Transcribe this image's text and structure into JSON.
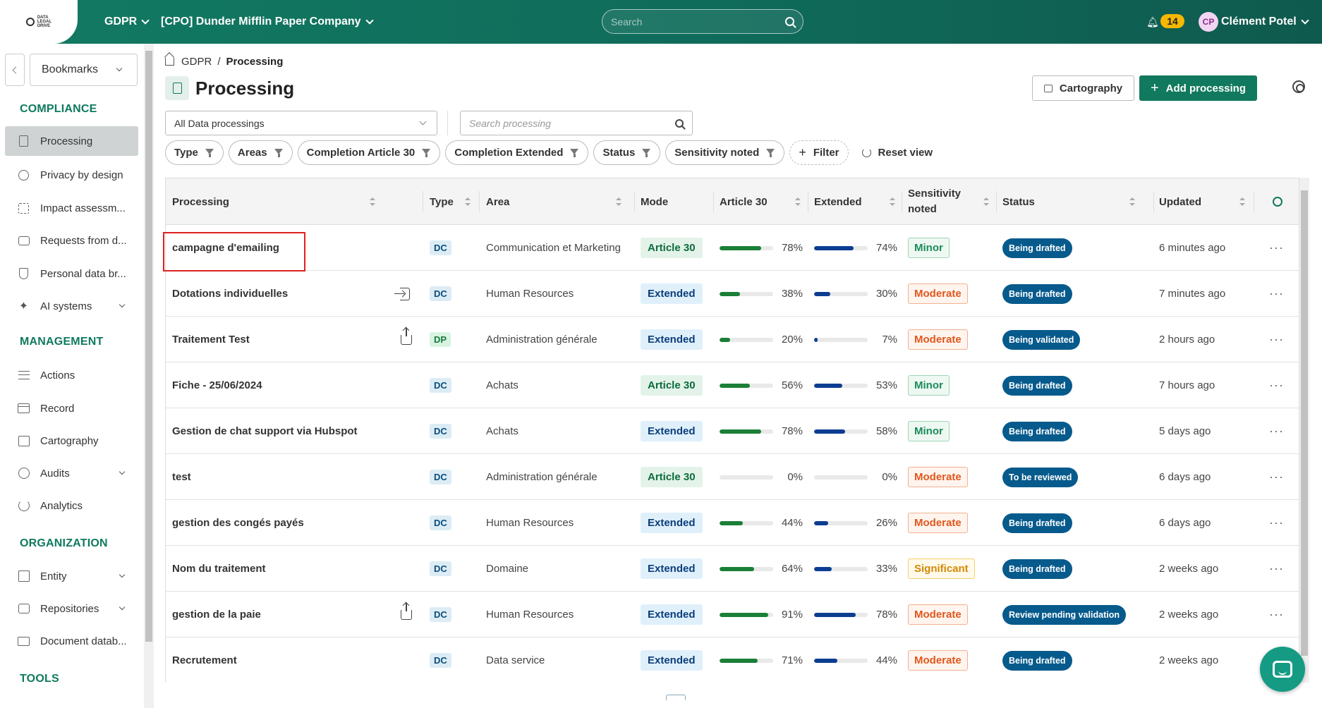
{
  "topbar": {
    "module": "GDPR",
    "company": "[CPO] Dunder Mifflin Paper Company",
    "search_placeholder": "Search",
    "notifications": "14",
    "avatar_initials": "CP",
    "user_name": "Clément Potel"
  },
  "sidebar": {
    "bookmarks_label": "Bookmarks",
    "sections": {
      "compliance": "COMPLIANCE",
      "management": "MANAGEMENT",
      "organization": "ORGANIZATION",
      "tools": "TOOLS"
    },
    "items": {
      "processing": "Processing",
      "privacy_by_design": "Privacy by design",
      "impact": "Impact assessm...",
      "requests": "Requests from d...",
      "personal_data": "Personal data br...",
      "ai_systems": "AI systems",
      "actions": "Actions",
      "record": "Record",
      "cartography": "Cartography",
      "audits": "Audits",
      "analytics": "Analytics",
      "entity": "Entity",
      "repositories": "Repositories",
      "document_db": "Document datab..."
    }
  },
  "breadcrumb": {
    "root": "GDPR",
    "separator": "/",
    "current": "Processing"
  },
  "page": {
    "title": "Processing",
    "cartography_btn": "Cartography",
    "add_btn": "Add processing",
    "filter_select": "All Data processings",
    "search_placeholder": "Search processing"
  },
  "filters": {
    "type": "Type",
    "areas": "Areas",
    "completion_a30": "Completion Article 30",
    "completion_ext": "Completion Extended",
    "status": "Status",
    "sensitivity": "Sensitivity noted",
    "add_filter": "Filter",
    "reset": "Reset view"
  },
  "table": {
    "headers": {
      "processing": "Processing",
      "type": "Type",
      "area": "Area",
      "mode": "Mode",
      "article30": "Article 30",
      "extended": "Extended",
      "sensitivity_1": "Sensitivity",
      "sensitivity_2": "noted",
      "status": "Status",
      "updated": "Updated"
    },
    "rows": [
      {
        "name": "campagne d'emailing",
        "icon": "",
        "type": "DC",
        "area": "Communication et Marketing",
        "mode": "Article 30",
        "a30": 78,
        "a30_label": "78%",
        "ext": 74,
        "ext_label": "74%",
        "sensitivity": "Minor",
        "status": "Being drafted",
        "updated": "6 minutes ago"
      },
      {
        "name": "Dotations individuelles",
        "icon": "import",
        "type": "DC",
        "area": "Human Resources",
        "mode": "Extended",
        "a30": 38,
        "a30_label": "38%",
        "ext": 30,
        "ext_label": "30%",
        "sensitivity": "Moderate",
        "status": "Being drafted",
        "updated": "7 minutes ago"
      },
      {
        "name": "Traitement Test",
        "icon": "export",
        "type": "DP",
        "area": "Administration générale",
        "mode": "Extended",
        "a30": 20,
        "a30_label": "20%",
        "ext": 7,
        "ext_label": "7%",
        "sensitivity": "Moderate",
        "status": "Being validated",
        "updated": "2 hours ago"
      },
      {
        "name": "Fiche - 25/06/2024",
        "icon": "",
        "type": "DC",
        "area": "Achats",
        "mode": "Article 30",
        "a30": 56,
        "a30_label": "56%",
        "ext": 53,
        "ext_label": "53%",
        "sensitivity": "Minor",
        "status": "Being drafted",
        "updated": "7 hours ago"
      },
      {
        "name": "Gestion de chat support via Hubspot",
        "icon": "",
        "type": "DC",
        "area": "Achats",
        "mode": "Extended",
        "a30": 78,
        "a30_label": "78%",
        "ext": 58,
        "ext_label": "58%",
        "sensitivity": "Minor",
        "status": "Being drafted",
        "updated": "5 days ago"
      },
      {
        "name": "test",
        "icon": "",
        "type": "DC",
        "area": "Administration générale",
        "mode": "Article 30",
        "a30": 0,
        "a30_label": "0%",
        "ext": 0,
        "ext_label": "0%",
        "sensitivity": "Moderate",
        "status": "To be reviewed",
        "updated": "6 days ago"
      },
      {
        "name": "gestion des congés payés",
        "icon": "",
        "type": "DC",
        "area": "Human Resources",
        "mode": "Extended",
        "a30": 44,
        "a30_label": "44%",
        "ext": 26,
        "ext_label": "26%",
        "sensitivity": "Moderate",
        "status": "Being drafted",
        "updated": "6 days ago"
      },
      {
        "name": "Nom du traitement",
        "icon": "",
        "type": "DC",
        "area": "Domaine",
        "mode": "Extended",
        "a30": 64,
        "a30_label": "64%",
        "ext": 33,
        "ext_label": "33%",
        "sensitivity": "Significant",
        "status": "Being drafted",
        "updated": "2 weeks ago"
      },
      {
        "name": "gestion de la paie",
        "icon": "export",
        "type": "DC",
        "area": "Human Resources",
        "mode": "Extended",
        "a30": 91,
        "a30_label": "91%",
        "ext": 78,
        "ext_label": "78%",
        "sensitivity": "Moderate",
        "status": "Review pending validation",
        "updated": "2 weeks ago"
      },
      {
        "name": "Recrutement",
        "icon": "",
        "type": "DC",
        "area": "Data service",
        "mode": "Extended",
        "a30": 71,
        "a30_label": "71%",
        "ext": 44,
        "ext_label": "44%",
        "sensitivity": "Moderate",
        "status": "Being drafted",
        "updated": "2 weeks ago"
      }
    ]
  },
  "colors": {
    "brand": "#127a62",
    "bar_a30": "#1b7f37",
    "bar_ext": "#0c3d91",
    "status": "#075a8c",
    "minor": "#1a8a5b",
    "moderate": "#e0571d",
    "significant": "#d48806"
  }
}
